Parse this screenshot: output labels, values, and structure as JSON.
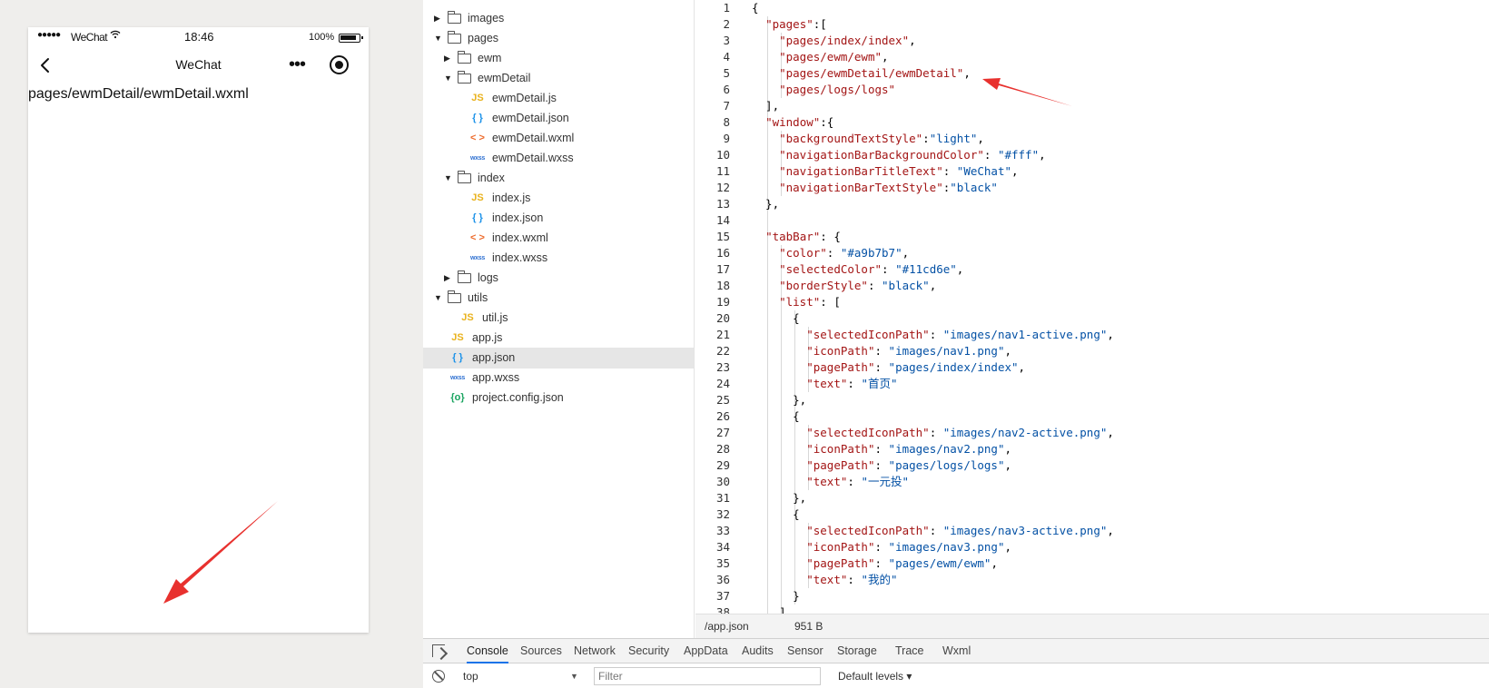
{
  "simulator": {
    "status_bar": {
      "signal": "●●●●●",
      "carrier": "WeChat",
      "time": "18:46",
      "battery": "100%"
    },
    "nav_bar": {
      "title": "WeChat",
      "more": "•••"
    },
    "page_content": "pages/ewmDetail/ewmDetail.wxml"
  },
  "file_tree": {
    "items": [
      {
        "name": "images",
        "type": "folder",
        "expanded": false,
        "depth": 0
      },
      {
        "name": "pages",
        "type": "folder",
        "expanded": true,
        "depth": 0
      },
      {
        "name": "ewm",
        "type": "folder",
        "expanded": false,
        "depth": 1
      },
      {
        "name": "ewmDetail",
        "type": "folder",
        "expanded": true,
        "depth": 1
      },
      {
        "name": "ewmDetail.js",
        "type": "js",
        "depth": 2
      },
      {
        "name": "ewmDetail.json",
        "type": "json",
        "depth": 2
      },
      {
        "name": "ewmDetail.wxml",
        "type": "wxml",
        "depth": 2
      },
      {
        "name": "ewmDetail.wxss",
        "type": "wxss",
        "depth": 2
      },
      {
        "name": "index",
        "type": "folder",
        "expanded": true,
        "depth": 1
      },
      {
        "name": "index.js",
        "type": "js",
        "depth": 2
      },
      {
        "name": "index.json",
        "type": "json",
        "depth": 2
      },
      {
        "name": "index.wxml",
        "type": "wxml",
        "depth": 2
      },
      {
        "name": "index.wxss",
        "type": "wxss",
        "depth": 2
      },
      {
        "name": "logs",
        "type": "folder",
        "expanded": false,
        "depth": 1
      },
      {
        "name": "utils",
        "type": "folder",
        "expanded": true,
        "depth": 0
      },
      {
        "name": "util.js",
        "type": "js",
        "depth": 1
      },
      {
        "name": "app.js",
        "type": "js",
        "depth": 0
      },
      {
        "name": "app.json",
        "type": "json",
        "depth": 0,
        "selected": true
      },
      {
        "name": "app.wxss",
        "type": "wxss",
        "depth": 0
      },
      {
        "name": "project.config.json",
        "type": "config",
        "depth": 0
      }
    ],
    "icon_glyphs": {
      "js": "JS",
      "json": "{ }",
      "wxml": "< >",
      "wxss": "wxss",
      "config": "{o}"
    }
  },
  "editor": {
    "lines": [
      [
        {
          "t": "{",
          "c": "p"
        }
      ],
      [
        {
          "t": "  ",
          "c": "p"
        },
        {
          "t": "\"pages\"",
          "c": "k"
        },
        {
          "t": ":[",
          "c": "p"
        }
      ],
      [
        {
          "t": "    ",
          "c": "p"
        },
        {
          "t": "\"pages/index/index\"",
          "c": "k"
        },
        {
          "t": ",",
          "c": "p"
        }
      ],
      [
        {
          "t": "    ",
          "c": "p"
        },
        {
          "t": "\"pages/ewm/ewm\"",
          "c": "k"
        },
        {
          "t": ",",
          "c": "p"
        }
      ],
      [
        {
          "t": "    ",
          "c": "p"
        },
        {
          "t": "\"pages/ewmDetail/ewmDetail\"",
          "c": "k"
        },
        {
          "t": ",",
          "c": "p"
        }
      ],
      [
        {
          "t": "    ",
          "c": "p"
        },
        {
          "t": "\"pages/logs/logs\"",
          "c": "k"
        }
      ],
      [
        {
          "t": "  ],",
          "c": "p"
        }
      ],
      [
        {
          "t": "  ",
          "c": "p"
        },
        {
          "t": "\"window\"",
          "c": "k"
        },
        {
          "t": ":{",
          "c": "p"
        }
      ],
      [
        {
          "t": "    ",
          "c": "p"
        },
        {
          "t": "\"backgroundTextStyle\"",
          "c": "k"
        },
        {
          "t": ":",
          "c": "p"
        },
        {
          "t": "\"light\"",
          "c": "s"
        },
        {
          "t": ",",
          "c": "p"
        }
      ],
      [
        {
          "t": "    ",
          "c": "p"
        },
        {
          "t": "\"navigationBarBackgroundColor\"",
          "c": "k"
        },
        {
          "t": ": ",
          "c": "p"
        },
        {
          "t": "\"#fff\"",
          "c": "s"
        },
        {
          "t": ",",
          "c": "p"
        }
      ],
      [
        {
          "t": "    ",
          "c": "p"
        },
        {
          "t": "\"navigationBarTitleText\"",
          "c": "k"
        },
        {
          "t": ": ",
          "c": "p"
        },
        {
          "t": "\"WeChat\"",
          "c": "s"
        },
        {
          "t": ",",
          "c": "p"
        }
      ],
      [
        {
          "t": "    ",
          "c": "p"
        },
        {
          "t": "\"navigationBarTextStyle\"",
          "c": "k"
        },
        {
          "t": ":",
          "c": "p"
        },
        {
          "t": "\"black\"",
          "c": "s"
        }
      ],
      [
        {
          "t": "  },",
          "c": "p"
        }
      ],
      [
        {
          "t": "",
          "c": "p"
        }
      ],
      [
        {
          "t": "  ",
          "c": "p"
        },
        {
          "t": "\"tabBar\"",
          "c": "k"
        },
        {
          "t": ": {",
          "c": "p"
        }
      ],
      [
        {
          "t": "    ",
          "c": "p"
        },
        {
          "t": "\"color\"",
          "c": "k"
        },
        {
          "t": ": ",
          "c": "p"
        },
        {
          "t": "\"#a9b7b7\"",
          "c": "s"
        },
        {
          "t": ",",
          "c": "p"
        }
      ],
      [
        {
          "t": "    ",
          "c": "p"
        },
        {
          "t": "\"selectedColor\"",
          "c": "k"
        },
        {
          "t": ": ",
          "c": "p"
        },
        {
          "t": "\"#11cd6e\"",
          "c": "s"
        },
        {
          "t": ",",
          "c": "p"
        }
      ],
      [
        {
          "t": "    ",
          "c": "p"
        },
        {
          "t": "\"borderStyle\"",
          "c": "k"
        },
        {
          "t": ": ",
          "c": "p"
        },
        {
          "t": "\"black\"",
          "c": "s"
        },
        {
          "t": ",",
          "c": "p"
        }
      ],
      [
        {
          "t": "    ",
          "c": "p"
        },
        {
          "t": "\"list\"",
          "c": "k"
        },
        {
          "t": ": [",
          "c": "p"
        }
      ],
      [
        {
          "t": "      {",
          "c": "p"
        }
      ],
      [
        {
          "t": "        ",
          "c": "p"
        },
        {
          "t": "\"selectedIconPath\"",
          "c": "k"
        },
        {
          "t": ": ",
          "c": "p"
        },
        {
          "t": "\"images/nav1-active.png\"",
          "c": "s"
        },
        {
          "t": ",",
          "c": "p"
        }
      ],
      [
        {
          "t": "        ",
          "c": "p"
        },
        {
          "t": "\"iconPath\"",
          "c": "k"
        },
        {
          "t": ": ",
          "c": "p"
        },
        {
          "t": "\"images/nav1.png\"",
          "c": "s"
        },
        {
          "t": ",",
          "c": "p"
        }
      ],
      [
        {
          "t": "        ",
          "c": "p"
        },
        {
          "t": "\"pagePath\"",
          "c": "k"
        },
        {
          "t": ": ",
          "c": "p"
        },
        {
          "t": "\"pages/index/index\"",
          "c": "s"
        },
        {
          "t": ",",
          "c": "p"
        }
      ],
      [
        {
          "t": "        ",
          "c": "p"
        },
        {
          "t": "\"text\"",
          "c": "k"
        },
        {
          "t": ": ",
          "c": "p"
        },
        {
          "t": "\"首页\"",
          "c": "s"
        }
      ],
      [
        {
          "t": "      },",
          "c": "p"
        }
      ],
      [
        {
          "t": "      {",
          "c": "p"
        }
      ],
      [
        {
          "t": "        ",
          "c": "p"
        },
        {
          "t": "\"selectedIconPath\"",
          "c": "k"
        },
        {
          "t": ": ",
          "c": "p"
        },
        {
          "t": "\"images/nav2-active.png\"",
          "c": "s"
        },
        {
          "t": ",",
          "c": "p"
        }
      ],
      [
        {
          "t": "        ",
          "c": "p"
        },
        {
          "t": "\"iconPath\"",
          "c": "k"
        },
        {
          "t": ": ",
          "c": "p"
        },
        {
          "t": "\"images/nav2.png\"",
          "c": "s"
        },
        {
          "t": ",",
          "c": "p"
        }
      ],
      [
        {
          "t": "        ",
          "c": "p"
        },
        {
          "t": "\"pagePath\"",
          "c": "k"
        },
        {
          "t": ": ",
          "c": "p"
        },
        {
          "t": "\"pages/logs/logs\"",
          "c": "s"
        },
        {
          "t": ",",
          "c": "p"
        }
      ],
      [
        {
          "t": "        ",
          "c": "p"
        },
        {
          "t": "\"text\"",
          "c": "k"
        },
        {
          "t": ": ",
          "c": "p"
        },
        {
          "t": "\"一元投\"",
          "c": "s"
        }
      ],
      [
        {
          "t": "      },",
          "c": "p"
        }
      ],
      [
        {
          "t": "      {",
          "c": "p"
        }
      ],
      [
        {
          "t": "        ",
          "c": "p"
        },
        {
          "t": "\"selectedIconPath\"",
          "c": "k"
        },
        {
          "t": ": ",
          "c": "p"
        },
        {
          "t": "\"images/nav3-active.png\"",
          "c": "s"
        },
        {
          "t": ",",
          "c": "p"
        }
      ],
      [
        {
          "t": "        ",
          "c": "p"
        },
        {
          "t": "\"iconPath\"",
          "c": "k"
        },
        {
          "t": ": ",
          "c": "p"
        },
        {
          "t": "\"images/nav3.png\"",
          "c": "s"
        },
        {
          "t": ",",
          "c": "p"
        }
      ],
      [
        {
          "t": "        ",
          "c": "p"
        },
        {
          "t": "\"pagePath\"",
          "c": "k"
        },
        {
          "t": ": ",
          "c": "p"
        },
        {
          "t": "\"pages/ewm/ewm\"",
          "c": "s"
        },
        {
          "t": ",",
          "c": "p"
        }
      ],
      [
        {
          "t": "        ",
          "c": "p"
        },
        {
          "t": "\"text\"",
          "c": "k"
        },
        {
          "t": ": ",
          "c": "p"
        },
        {
          "t": "\"我的\"",
          "c": "s"
        }
      ],
      [
        {
          "t": "      }",
          "c": "p"
        }
      ],
      [
        {
          "t": "    ]",
          "c": "p"
        }
      ]
    ],
    "status": {
      "path": "/app.json",
      "size": "951 B"
    }
  },
  "devtools": {
    "tabs": [
      "Console",
      "Sources",
      "Network",
      "Security",
      "AppData",
      "Audits",
      "Sensor",
      "Storage",
      "Trace",
      "Wxml"
    ],
    "active_tab": "Console",
    "context": "top",
    "filter_placeholder": "Filter",
    "levels": "Default levels ▾"
  },
  "colors": {
    "annotation_arrow": "#e8312e",
    "json_key": "#a31515",
    "json_string": "#0451a5",
    "selection": "#e6e6e6"
  }
}
